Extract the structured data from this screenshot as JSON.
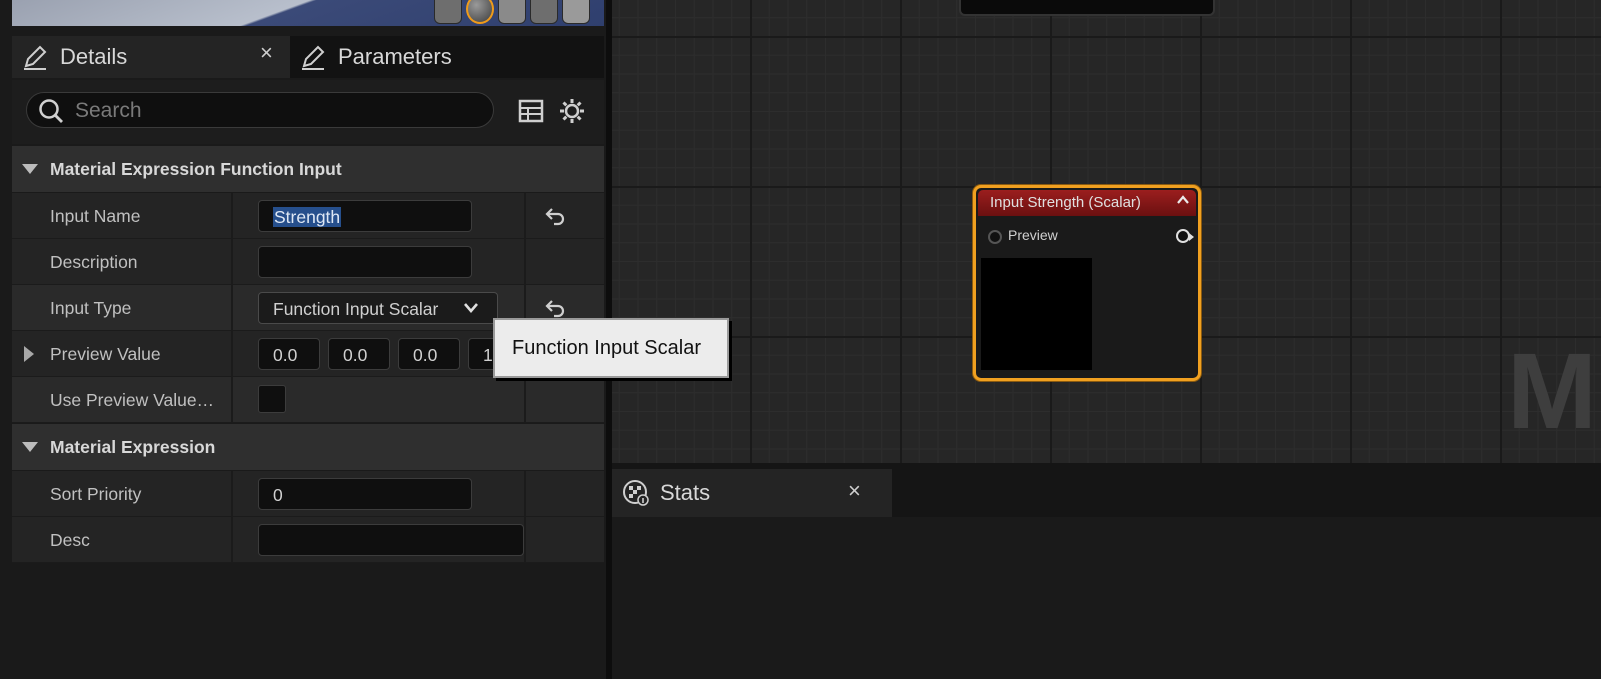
{
  "details_panel": {
    "tabs": [
      {
        "label": "Details",
        "close": "×"
      },
      {
        "label": "Parameters"
      }
    ],
    "search": {
      "placeholder": "Search",
      "value": ""
    },
    "categories": [
      {
        "title": "Material Expression Function Input",
        "properties": [
          {
            "label": "Input Name",
            "value": "Strength"
          },
          {
            "label": "Description",
            "value": ""
          },
          {
            "label": "Input Type",
            "value": "Function Input Scalar"
          },
          {
            "label": "Preview Value",
            "values": [
              "0.0",
              "0.0",
              "0.0",
              "1"
            ]
          },
          {
            "label": "Use Preview Value…",
            "checked": false
          }
        ]
      },
      {
        "title": "Material Expression",
        "properties": [
          {
            "label": "Sort Priority",
            "value": "0"
          },
          {
            "label": "Desc",
            "value": ""
          }
        ]
      }
    ],
    "tooltip": "Function Input Scalar"
  },
  "graph": {
    "node": {
      "title": "Input Strength (Scalar)",
      "collapse": "^",
      "pin_label": "Preview"
    },
    "watermark": "MA"
  },
  "stats_panel": {
    "label": "Stats",
    "close": "×"
  },
  "colors": {
    "selection": "#264f8c",
    "node_outline": "#f0a020",
    "node_header": "#8b1a1a"
  }
}
